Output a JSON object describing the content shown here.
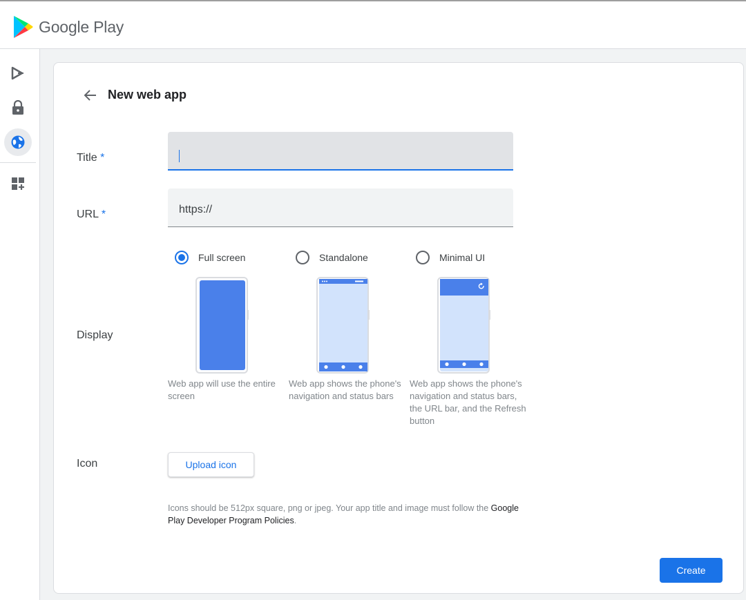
{
  "app": {
    "name": "Google Play"
  },
  "sidebar": {
    "items": [
      {
        "name": "play-console-icon"
      },
      {
        "name": "lock-icon"
      },
      {
        "name": "globe-icon",
        "active": true
      },
      {
        "name": "add-apps-icon"
      }
    ]
  },
  "page": {
    "title": "New web app"
  },
  "form": {
    "title": {
      "label": "Title",
      "required_mark": "*",
      "value": ""
    },
    "url": {
      "label": "URL",
      "required_mark": "*",
      "value": "https://"
    },
    "display": {
      "label": "Display",
      "selected": "Full screen",
      "options": [
        {
          "label": "Full screen",
          "description": "Web app will use the entire screen"
        },
        {
          "label": "Standalone",
          "description": "Web app shows the phone's navigation and status bars"
        },
        {
          "label": "Minimal UI",
          "description": "Web app shows the phone's navigation and status bars, the URL bar, and the Refresh button"
        }
      ]
    },
    "icon": {
      "label": "Icon",
      "upload_label": "Upload icon",
      "note": "Icons should be 512px square, png or jpeg. Your app title and image must follow the ",
      "policy_link": "Google Play Developer Program Policies",
      "note_end": "."
    }
  },
  "actions": {
    "create_label": "Create"
  },
  "colors": {
    "accent": "#1a73e8",
    "phone_screen": "#d2e3fc",
    "phone_fill": "#4a80ea"
  }
}
